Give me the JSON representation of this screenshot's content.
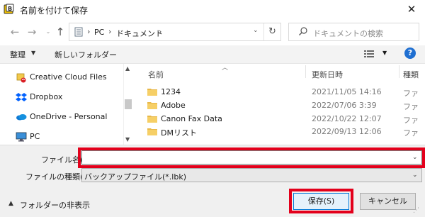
{
  "window": {
    "title": "名前を付けて保存",
    "close_glyph": "✕"
  },
  "nav": {
    "back_glyph": "←",
    "forward_glyph": "→",
    "recent_glyph": "⌄",
    "up_glyph": "↑",
    "breadcrumb": [
      "PC",
      "ドキュメント"
    ],
    "crumb_sep": "›",
    "refresh_glyph": "↻",
    "search_placeholder": "ドキュメントの検索"
  },
  "toolbar": {
    "organize_label": "整理",
    "organize_caret": "▼",
    "new_folder_label": "新しいフォルダー",
    "view_caret": "▼",
    "help_label": "?"
  },
  "sidebar": {
    "items": [
      {
        "label": "Creative Cloud Files",
        "icon": "creative-cloud-icon"
      },
      {
        "label": "Dropbox",
        "icon": "dropbox-icon"
      },
      {
        "label": "OneDrive - Personal",
        "icon": "onedrive-icon"
      },
      {
        "label": "PC",
        "icon": "pc-icon"
      }
    ],
    "scroll_up": "▲",
    "scroll_down": "▼"
  },
  "files": {
    "columns": [
      "名前",
      "更新日時",
      "種類"
    ],
    "sort_caret": "︿",
    "rows": [
      {
        "name": "1234",
        "modified": "2021/11/05 14:16",
        "type": "ファ"
      },
      {
        "name": "Adobe",
        "modified": "2022/07/06 3:39",
        "type": "ファ"
      },
      {
        "name": "Canon Fax Data",
        "modified": "2022/10/22 12:07",
        "type": "ファ"
      },
      {
        "name": "DMリスト",
        "modified": "2022/09/13 12:06",
        "type": "ファ"
      }
    ]
  },
  "form": {
    "filename_label": "ファイル名(N):",
    "filename_value": "",
    "filetype_label": "ファイルの種類(T):",
    "filetype_value": "バックアップファイル(*.lbk)",
    "dropdown_caret": "⌄"
  },
  "footer": {
    "hide_folders_caret": "▲",
    "hide_folders_label": "フォルダーの非表示",
    "save_label": "保存(S)",
    "cancel_label": "キャンセル",
    "grip": "⋰"
  },
  "colors": {
    "highlight": "#e3001b",
    "accent": "#0078d7",
    "folder": "#e8b84a"
  }
}
